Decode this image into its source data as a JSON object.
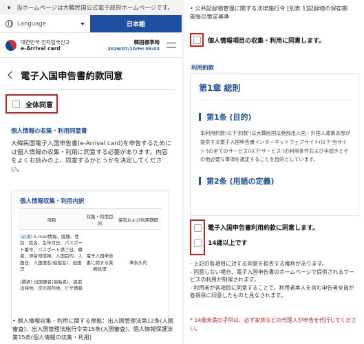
{
  "gov_banner": {
    "text": "当ホームページは大韓民国公式電子政府ホームページです。"
  },
  "lang": {
    "select_label": "Language",
    "current": "日本語"
  },
  "header": {
    "logo_line1": "대한민국 전자입국신고",
    "logo_line2": "e-Arrival card",
    "clock_label": "韓国標準時",
    "clock_value": "2026/07/10/Fri 05:02"
  },
  "page_title": "電子入国申告書約款同意",
  "agree_all": "全体同意",
  "privacy": {
    "title": "個人情報の収集・利用同意書",
    "intro": "大韓民国電子入国申告書(e-Arrival card)を申告するためには個人情報の収集・利用に同意する必要があります。内容をよくお読みの上、同意するかどうかを決定してください。"
  },
  "table": {
    "title": "個人情報収集・利用内訳",
    "headers": [
      "項目",
      "収集・利用目的",
      "保有および利用期間"
    ],
    "required_tag": "(必須)",
    "required_items": "E-mail情報、国籍、性別、姓名、生年月日、パスポート番号、パスポート満了日、職業、滞留地情報、入国目的、入国日、入国便名(船舶名)、出国日",
    "optional_tag": "(選択)",
    "optional_items": "出国便名(船舶名)、直前出発地、次の目的地、ビザ情報",
    "purpose": "電子入国申告書に関する業務処理",
    "period": "準永久的"
  },
  "basis_note": "• 個人情報収集・利用に関する根拠：出入国管理法第12条(入国審査)、出入国管理法施行令第15条(入国審査)、個人情報保護法第15条(個人情報の収集・利用)",
  "right": {
    "top_text": "• 公共記録物管理に関する法律施行令 [別表 1]記録物の保存期間毎の策定基準",
    "consent_privacy": "個人情報項目の収集・利用に同意します。",
    "terms_label": "利用約款",
    "chapter": "第1章 総則",
    "article1": "第1条 (目的)",
    "article1_text": "本利用約款(以下'約款')は大韓民国法務部出入国・外国人政策本部が提供する電子入国申告書インターネットウェブサイト(以下'当サイト')の全てのサービス(以下'サービス')の利用条件および手続きとその他必要な事項を規定することを目的としています。",
    "article2": "第2条 (用語の定義)",
    "consent_terms": "電子入国申告書利用約款に同意します。",
    "consent_age": "14歳以上です",
    "bullet1": "- 上記の各項目に対する同意を拒否する権利があります。",
    "bullet2": "- 同意しない場合、電子入国申告書のホームページで提供されるサービスの利用が制限されます。",
    "bullet3": "- 利用者が各項目に同意することで、利用者本人を含む申告者全員が各項目に同意したものと見なされます。",
    "warning": "* 14歳未満の子供は、必ず家族などの代理人が申告を代行してください。"
  },
  "colors": {
    "accent": "#1f4fa0",
    "highlight": "#d61b1b"
  }
}
